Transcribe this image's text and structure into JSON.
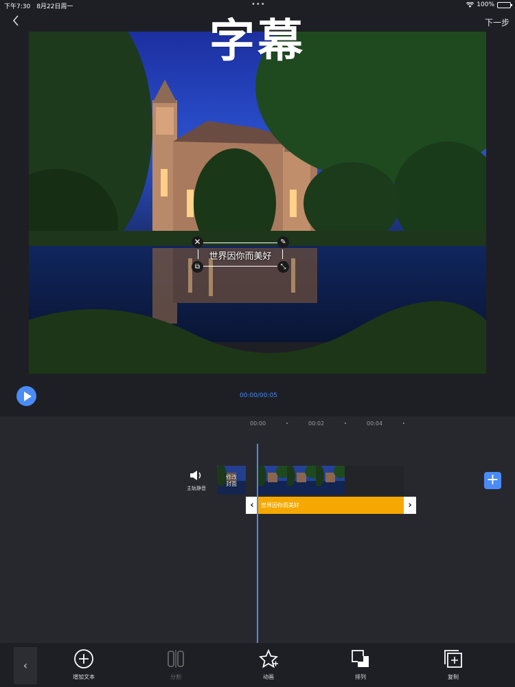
{
  "status_bar": {
    "time_date": "下午7:30　8月22日周一",
    "battery": "100%",
    "battery_level": 1.0
  },
  "header": {
    "title": "字幕",
    "next_label": "下一步"
  },
  "preview": {
    "subtitle_text": "世界因你而美好"
  },
  "player": {
    "time": "00:00/00:05"
  },
  "timeline": {
    "ruler": [
      "00:00",
      "00:02",
      "00:04"
    ],
    "mute_label": "主轨静音",
    "cover_label": "修改\n封面",
    "text_clip_label": "世界因你而美好"
  },
  "toolbar": {
    "items": [
      {
        "label": "增加文本",
        "icon": "plus-circle-icon",
        "enabled": true
      },
      {
        "label": "分割",
        "icon": "split-icon",
        "enabled": false
      },
      {
        "label": "动画",
        "icon": "star-animation-icon",
        "enabled": true
      },
      {
        "label": "排列",
        "icon": "arrange-layers-icon",
        "enabled": true
      },
      {
        "label": "复制",
        "icon": "copy-icon",
        "enabled": true
      }
    ]
  },
  "colors": {
    "accent": "#4a8bf5",
    "clip": "#f5a800",
    "background": "#1e1f24"
  }
}
